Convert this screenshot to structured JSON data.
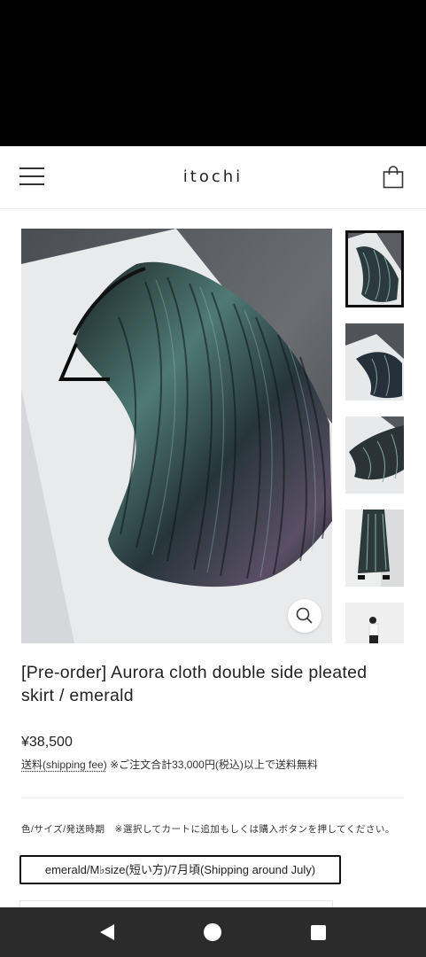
{
  "header": {
    "logo": "itochi",
    "menu_icon": "hamburger-menu-icon",
    "cart_icon": "shopping-bag-icon"
  },
  "product": {
    "title": "[Pre-order] Aurora cloth double side pleated skirt / emerald",
    "price": "¥38,500",
    "shipping_link": "送料(shipping fee)",
    "shipping_note": "※ご注文合計33,000円(税込)以上で送料無料",
    "option_label": "色/サイズ/発送時期　※選択してカートに追加もしくは購入ボタンを押してください。",
    "selected_option": "emerald/M♭size(短い方)/7月頃(Shipping around July)"
  },
  "gallery": {
    "zoom_icon": "magnifier-icon",
    "thumbnails": [
      "thumb-1",
      "thumb-2",
      "thumb-3",
      "thumb-4",
      "thumb-5"
    ],
    "active_index": 0
  },
  "nav": {
    "back_icon": "back-triangle-icon",
    "home_icon": "home-circle-icon",
    "recents_icon": "recents-square-icon"
  },
  "colors": {
    "status_bar": "#000000",
    "nav_bar": "#2b2b2b",
    "accent": "#111111",
    "skirt_dark": "#1f2a2b",
    "skirt_sheen": "#6f9a92"
  }
}
